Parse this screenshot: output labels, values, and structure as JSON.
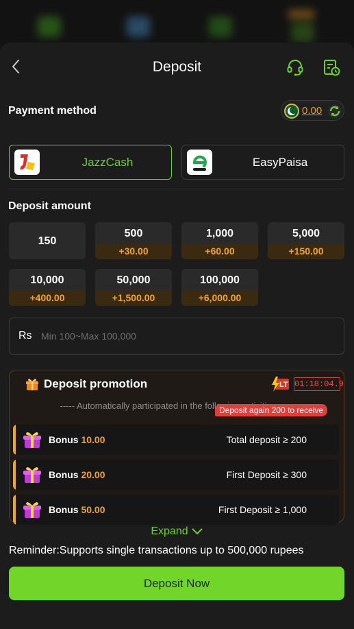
{
  "header": {
    "title": "Deposit"
  },
  "payment": {
    "label": "Payment method",
    "balance": "0.00",
    "methods": [
      {
        "name": "JazzCash",
        "selected": true
      },
      {
        "name": "EasyPaisa",
        "selected": false
      }
    ]
  },
  "amount": {
    "label": "Deposit amount",
    "options": [
      {
        "value": "150",
        "bonus": ""
      },
      {
        "value": "500",
        "bonus": "+30.00"
      },
      {
        "value": "1,000",
        "bonus": "+60.00"
      },
      {
        "value": "5,000",
        "bonus": "+150.00"
      },
      {
        "value": "10,000",
        "bonus": "+400.00"
      },
      {
        "value": "50,000",
        "bonus": "+1,500.00"
      },
      {
        "value": "100,000",
        "bonus": "+6,000.00"
      }
    ],
    "currency": "Rs",
    "placeholder": "Min 100~Max 100,000"
  },
  "promo": {
    "title": "Deposit promotion",
    "lt_badge": "LT",
    "timer": "01:18:04.9",
    "subtitle": "----- Automatically participated in the following activities -----",
    "again_tag": "Deposit again 200 to receive",
    "rows": [
      {
        "label": "Bonus",
        "value": "10.00",
        "condition": "Total deposit ≥ 200"
      },
      {
        "label": "Bonus",
        "value": "20.00",
        "condition": "First Deposit ≥ 300"
      },
      {
        "label": "Bonus",
        "value": "50.00",
        "condition": "First Deposit ≥ 1,000"
      }
    ],
    "expand": "Expand"
  },
  "reminder": "Reminder:Supports single transactions up to 500,000 rupees",
  "submit": "Deposit Now",
  "colors": {
    "accent": "#72d52a",
    "bonus": "#f0a623",
    "timer": "#f05050"
  }
}
